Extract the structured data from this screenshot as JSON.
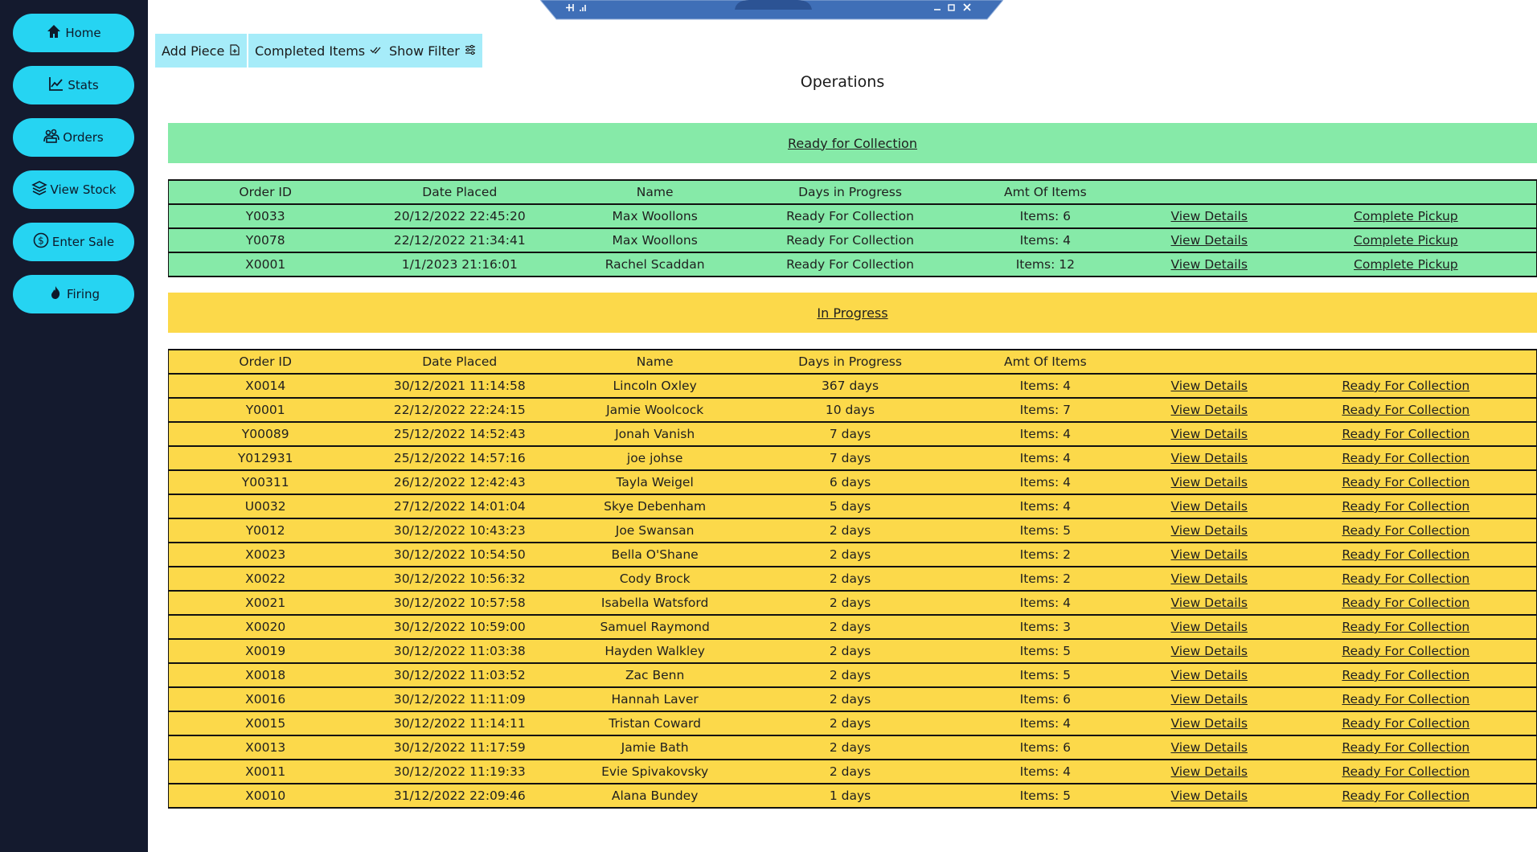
{
  "nav": [
    {
      "label": "Home",
      "icon": "home-icon"
    },
    {
      "label": "Stats",
      "icon": "chart-icon"
    },
    {
      "label": "Orders",
      "icon": "people-icon"
    },
    {
      "label": "View Stock",
      "icon": "layers-icon"
    },
    {
      "label": "Enter Sale",
      "icon": "dollar-icon"
    },
    {
      "label": "Firing",
      "icon": "flame-icon"
    }
  ],
  "toolbar": {
    "add_piece": "Add Piece",
    "completed_items": "Completed Items",
    "show_filter": "Show Filter"
  },
  "page_title": "Operations",
  "columns": [
    "Order ID",
    "Date Placed",
    "Name",
    "Days in Progress",
    "Amt Of Items"
  ],
  "colors": {
    "sidebar": "#141a2e",
    "nav_button": "#26d4f2",
    "toolbar_button": "#a6ecf9",
    "ready_band": "#86eaa8",
    "progress_band": "#fcd94a"
  },
  "ready": {
    "heading": "Ready for Collection",
    "rows": [
      [
        "Y0033",
        "20/12/2022 22:45:20",
        "Max Woollons",
        "Ready For Collection",
        "Items: 6",
        "View Details",
        "Complete Pickup"
      ],
      [
        "Y0078",
        "22/12/2022 21:34:41",
        "Max Woollons",
        "Ready For Collection",
        "Items: 4",
        "View Details",
        "Complete Pickup"
      ],
      [
        "X0001",
        "1/1/2023 21:16:01",
        "Rachel Scaddan",
        "Ready For Collection",
        "Items: 12",
        "View Details",
        "Complete Pickup"
      ]
    ]
  },
  "in_progress": {
    "heading": "In Progress",
    "rows": [
      [
        "X0014",
        "30/12/2021 11:14:58",
        "Lincoln Oxley",
        "367 days",
        "Items: 4",
        "View Details",
        "Ready For Collection"
      ],
      [
        "Y0001",
        "22/12/2022 22:24:15",
        "Jamie Woolcock",
        "10 days",
        "Items: 7",
        "View Details",
        "Ready For Collection"
      ],
      [
        "Y00089",
        "25/12/2022 14:52:43",
        "Jonah Vanish",
        "7 days",
        "Items: 4",
        "View Details",
        "Ready For Collection"
      ],
      [
        "Y012931",
        "25/12/2022 14:57:16",
        "joe johse",
        "7 days",
        "Items: 4",
        "View Details",
        "Ready For Collection"
      ],
      [
        "Y00311",
        "26/12/2022 12:42:43",
        "Tayla Weigel",
        "6 days",
        "Items: 4",
        "View Details",
        "Ready For Collection"
      ],
      [
        "U0032",
        "27/12/2022 14:01:04",
        "Skye Debenham",
        "5 days",
        "Items: 4",
        "View Details",
        "Ready For Collection"
      ],
      [
        "Y0012",
        "30/12/2022 10:43:23",
        "Joe Swansan",
        "2 days",
        "Items: 5",
        "View Details",
        "Ready For Collection"
      ],
      [
        "X0023",
        "30/12/2022 10:54:50",
        "Bella O'Shane",
        "2 days",
        "Items: 2",
        "View Details",
        "Ready For Collection"
      ],
      [
        "X0022",
        "30/12/2022 10:56:32",
        "Cody Brock",
        "2 days",
        "Items: 2",
        "View Details",
        "Ready For Collection"
      ],
      [
        "X0021",
        "30/12/2022 10:57:58",
        "Isabella Watsford",
        "2 days",
        "Items: 4",
        "View Details",
        "Ready For Collection"
      ],
      [
        "X0020",
        "30/12/2022 10:59:00",
        "Samuel Raymond",
        "2 days",
        "Items: 3",
        "View Details",
        "Ready For Collection"
      ],
      [
        "X0019",
        "30/12/2022 11:03:38",
        "Hayden Walkley",
        "2 days",
        "Items: 5",
        "View Details",
        "Ready For Collection"
      ],
      [
        "X0018",
        "30/12/2022 11:03:52",
        "Zac Benn",
        "2 days",
        "Items: 5",
        "View Details",
        "Ready For Collection"
      ],
      [
        "X0016",
        "30/12/2022 11:11:09",
        "Hannah Laver",
        "2 days",
        "Items: 6",
        "View Details",
        "Ready For Collection"
      ],
      [
        "X0015",
        "30/12/2022 11:14:11",
        "Tristan Coward",
        "2 days",
        "Items: 4",
        "View Details",
        "Ready For Collection"
      ],
      [
        "X0013",
        "30/12/2022 11:17:59",
        "Jamie Bath",
        "2 days",
        "Items: 6",
        "View Details",
        "Ready For Collection"
      ],
      [
        "X0011",
        "30/12/2022 11:19:33",
        "Evie Spivakovsky",
        "2 days",
        "Items: 4",
        "View Details",
        "Ready For Collection"
      ],
      [
        "X0010",
        "31/12/2022 22:09:46",
        "Alana Bundey",
        "1 days",
        "Items: 5",
        "View Details",
        "Ready For Collection"
      ]
    ]
  }
}
